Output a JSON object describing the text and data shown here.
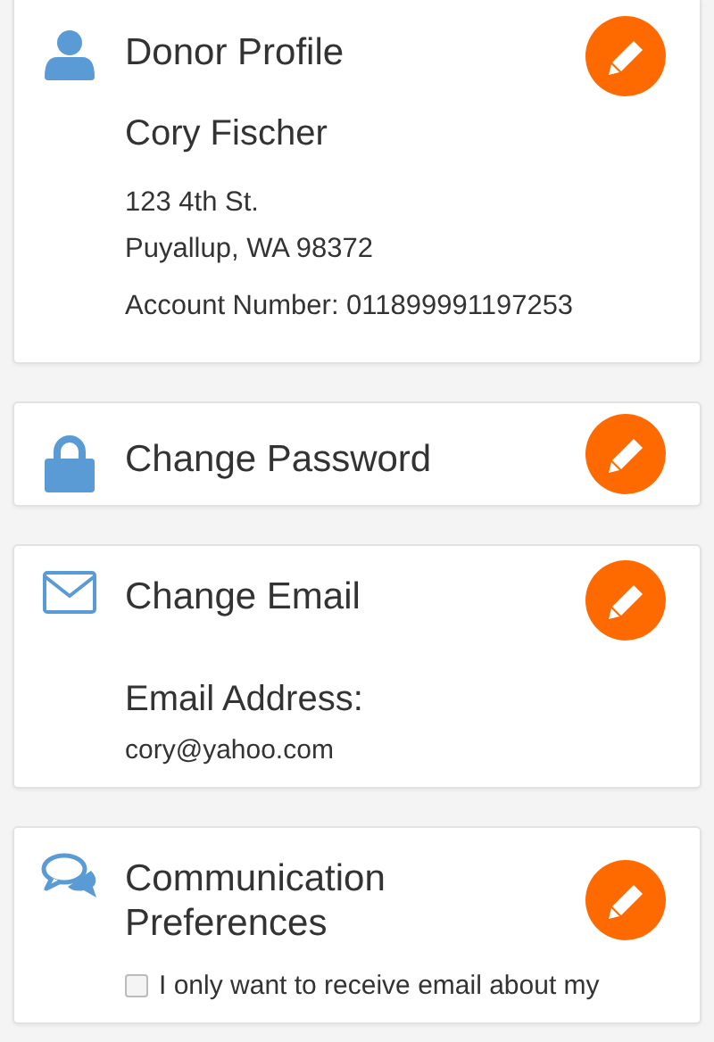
{
  "cards": [
    {
      "kind": "profile",
      "title": "Donor Profile",
      "name": "Cory Fischer",
      "address": [
        "123 4th St.",
        "Puyallup, WA 98372"
      ],
      "account": "Account Number: 011899991197253"
    },
    {
      "kind": "password",
      "title": "Change Password"
    },
    {
      "kind": "email",
      "title": "Change Email",
      "label": "Email Address:",
      "value": "cory@yahoo.com"
    },
    {
      "kind": "communication",
      "title": "Communication Preferences",
      "options": [
        {
          "label": "I only want to receive email about my",
          "checked": false
        }
      ]
    }
  ]
}
